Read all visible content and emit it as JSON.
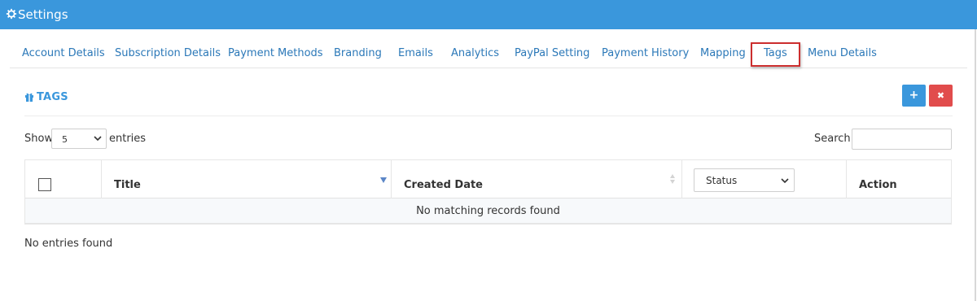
{
  "header": {
    "title": "Settings",
    "icon": "gear-icon",
    "bg_color": "#3a97dc"
  },
  "tabs": [
    {
      "label": "Account Details"
    },
    {
      "label": "Subscription Details"
    },
    {
      "label": "Payment Methods"
    },
    {
      "label": "Branding"
    },
    {
      "label": "Emails"
    },
    {
      "label": "Analytics"
    },
    {
      "label": "PayPal Setting"
    },
    {
      "label": "Payment History"
    },
    {
      "label": "Mapping"
    },
    {
      "label": "Tags"
    },
    {
      "label": "Menu Details"
    }
  ],
  "active_tab": "Tags",
  "section": {
    "title": "TAGS",
    "icon": "gift-icon",
    "add_icon": "plus-icon",
    "delete_icon": "close-icon",
    "add_symbol": "+",
    "delete_symbol": "✖",
    "add_color": "#3a97dc",
    "delete_color": "#e14c4c"
  },
  "length_menu": {
    "show_label": "Show",
    "value": "5",
    "entries_label": "entries"
  },
  "search": {
    "label": "Search:",
    "value": ""
  },
  "table": {
    "columns": {
      "title": "Title",
      "created_date": "Created Date",
      "status_filter": "Status",
      "action": "Action"
    },
    "empty_message": "No matching records found"
  },
  "info": "No entries found"
}
